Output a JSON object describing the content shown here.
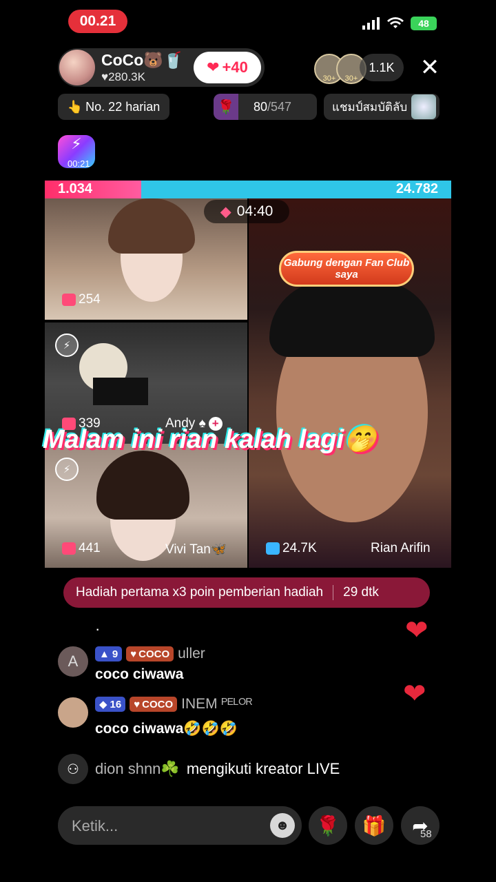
{
  "status_bar": {
    "time": "00.21",
    "battery": "48"
  },
  "host": {
    "name": "CoCo🐻🥤",
    "likes": "♥280.3K",
    "like_button": "+40"
  },
  "viewers": {
    "count": "1.1K",
    "avatar_labels": [
      "30+",
      "30+"
    ]
  },
  "rank": {
    "label": "No. 22 harian"
  },
  "goal": {
    "current": "80",
    "total": "/547"
  },
  "champion": {
    "label": "แชมป์สมบัติลับ"
  },
  "bolt_badge": {
    "time": "00:21"
  },
  "battle": {
    "score_left": "1.034",
    "score_right": "24.782",
    "timer": "04:40"
  },
  "fan_club_button": "Gabung dengan Fan Club saya",
  "tiles": [
    {
      "count": "254",
      "name": ""
    },
    {
      "count": "339",
      "name": "Andy ♠"
    },
    {
      "count": "441",
      "name": "Vivi Tan🦋"
    },
    {
      "count": "24.7K",
      "name": "Rian Arifin"
    }
  ],
  "overlay_text": "Malam ini rian kalah lagi🤭",
  "banner": {
    "text": "Hadiah pertama x3 poin pemberian hadiah",
    "countdown": "29 dtk"
  },
  "comments": [
    {
      "avatar_letter": "A",
      "level": "9",
      "fan_badge": "COCO",
      "user": "uller",
      "text": "coco ciwawa"
    },
    {
      "avatar_letter": "",
      "level": "16",
      "fan_badge": "COCO",
      "user": "INEM ᴾᴱᴸᴼᴿ",
      "text": "coco ciwawa🤣🤣🤣"
    }
  ],
  "follow_event": {
    "user": "dion shnn☘️",
    "text": "mengikuti kreator LIVE"
  },
  "comment_dot": "·",
  "input": {
    "placeholder": "Ketik..."
  },
  "share_count": "58",
  "colors": {
    "accent_red": "#e8283c",
    "battle_blue": "#2fc6e8",
    "banner": "#8a1838"
  }
}
